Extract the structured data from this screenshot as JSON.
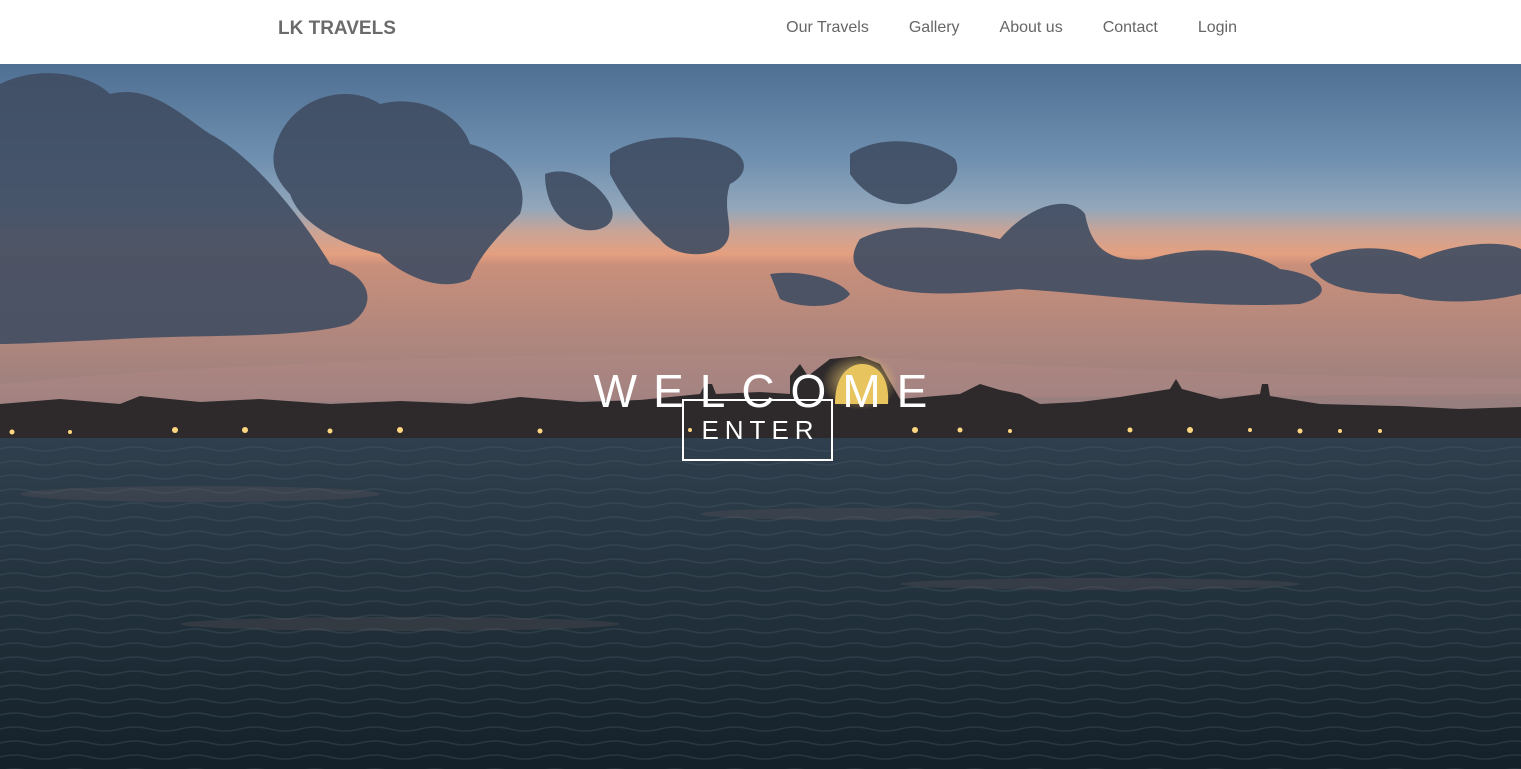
{
  "navbar": {
    "brand": "LK TRAVELS",
    "links": [
      {
        "label": "Our Travels"
      },
      {
        "label": "Gallery"
      },
      {
        "label": "About us"
      },
      {
        "label": "Contact"
      },
      {
        "label": "Login"
      }
    ]
  },
  "hero": {
    "heading": "WELCOME",
    "button_label": "ENTER",
    "background": "venice-sunset-lagoon-photo"
  },
  "colors": {
    "nav_text": "#666666",
    "brand_text": "#6b6b6b",
    "hero_text": "#ffffff"
  }
}
